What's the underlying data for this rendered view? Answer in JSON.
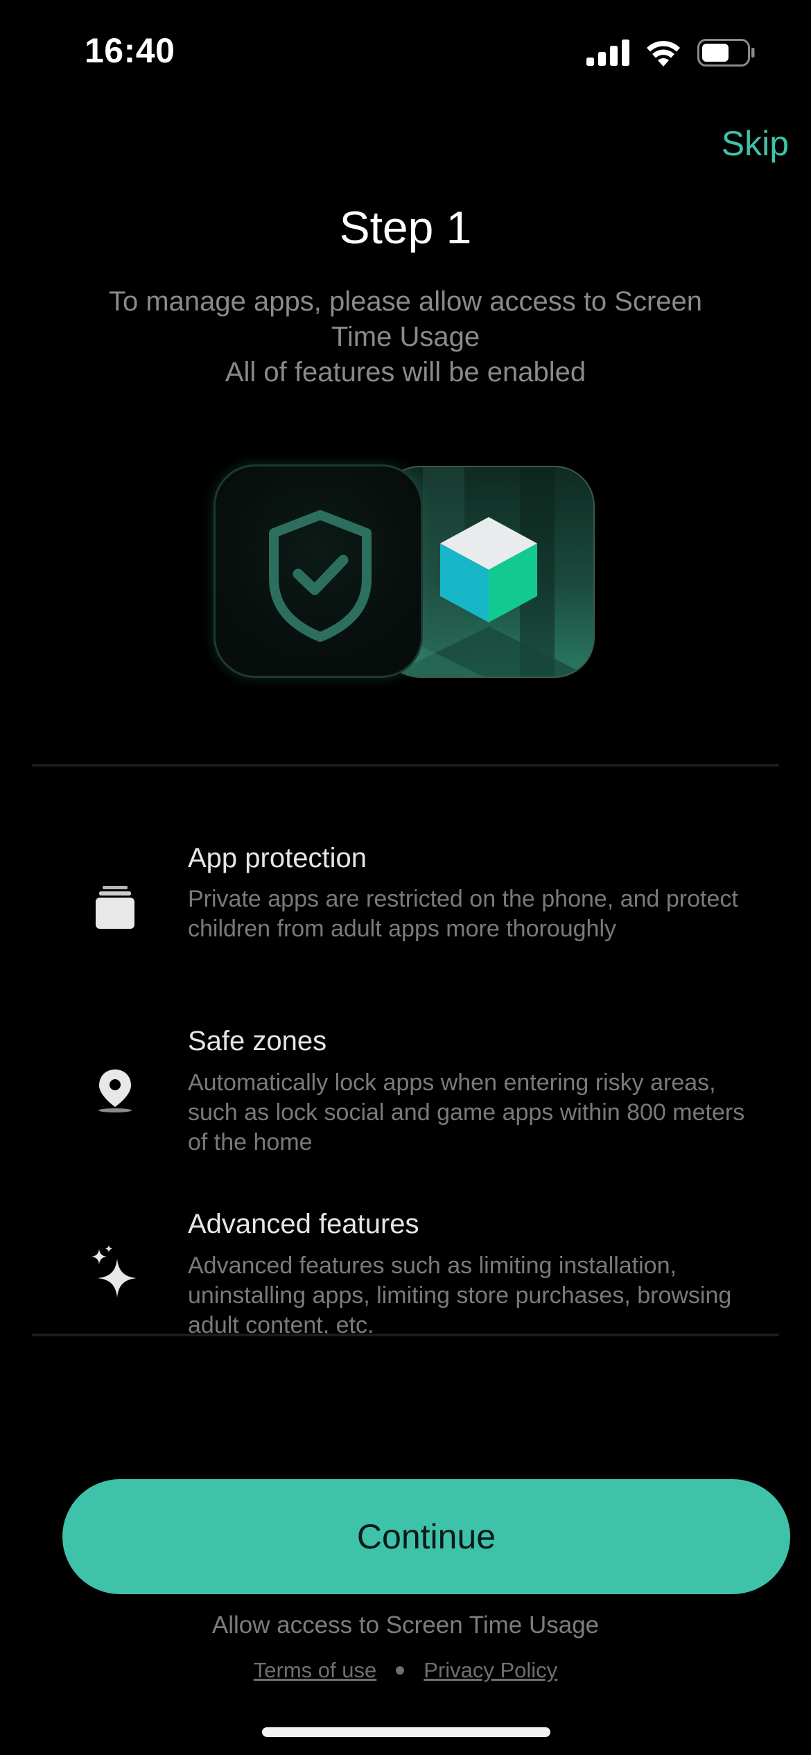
{
  "status_bar": {
    "time": "16:40"
  },
  "header": {
    "skip_label": "Skip",
    "title": "Step 1",
    "subtitle_lines": [
      "To manage apps,  please allow access to Screen",
      "Time Usage",
      "All of features will be enabled"
    ]
  },
  "features": [
    {
      "icon": "stack-icon",
      "title": "App protection",
      "description": "Private apps are restricted on the phone,  and protect children from adult apps more thoroughly"
    },
    {
      "icon": "location-pin-icon",
      "title": "Safe zones",
      "description": "Automatically lock apps when entering risky areas, such as lock social and game apps within 800 meters of the home"
    },
    {
      "icon": "sparkles-icon",
      "title": "Advanced features",
      "description": "Advanced features such as limiting installation, uninstalling apps, limiting store purchases, browsing adult content, etc."
    }
  ],
  "footer": {
    "continue_label": "Continue",
    "allow_text": "Allow access to Screen Time Usage",
    "terms_label": "Terms of use",
    "privacy_label": "Privacy Policy"
  },
  "colors": {
    "accent": "#3fc2aa",
    "background": "#000000"
  }
}
